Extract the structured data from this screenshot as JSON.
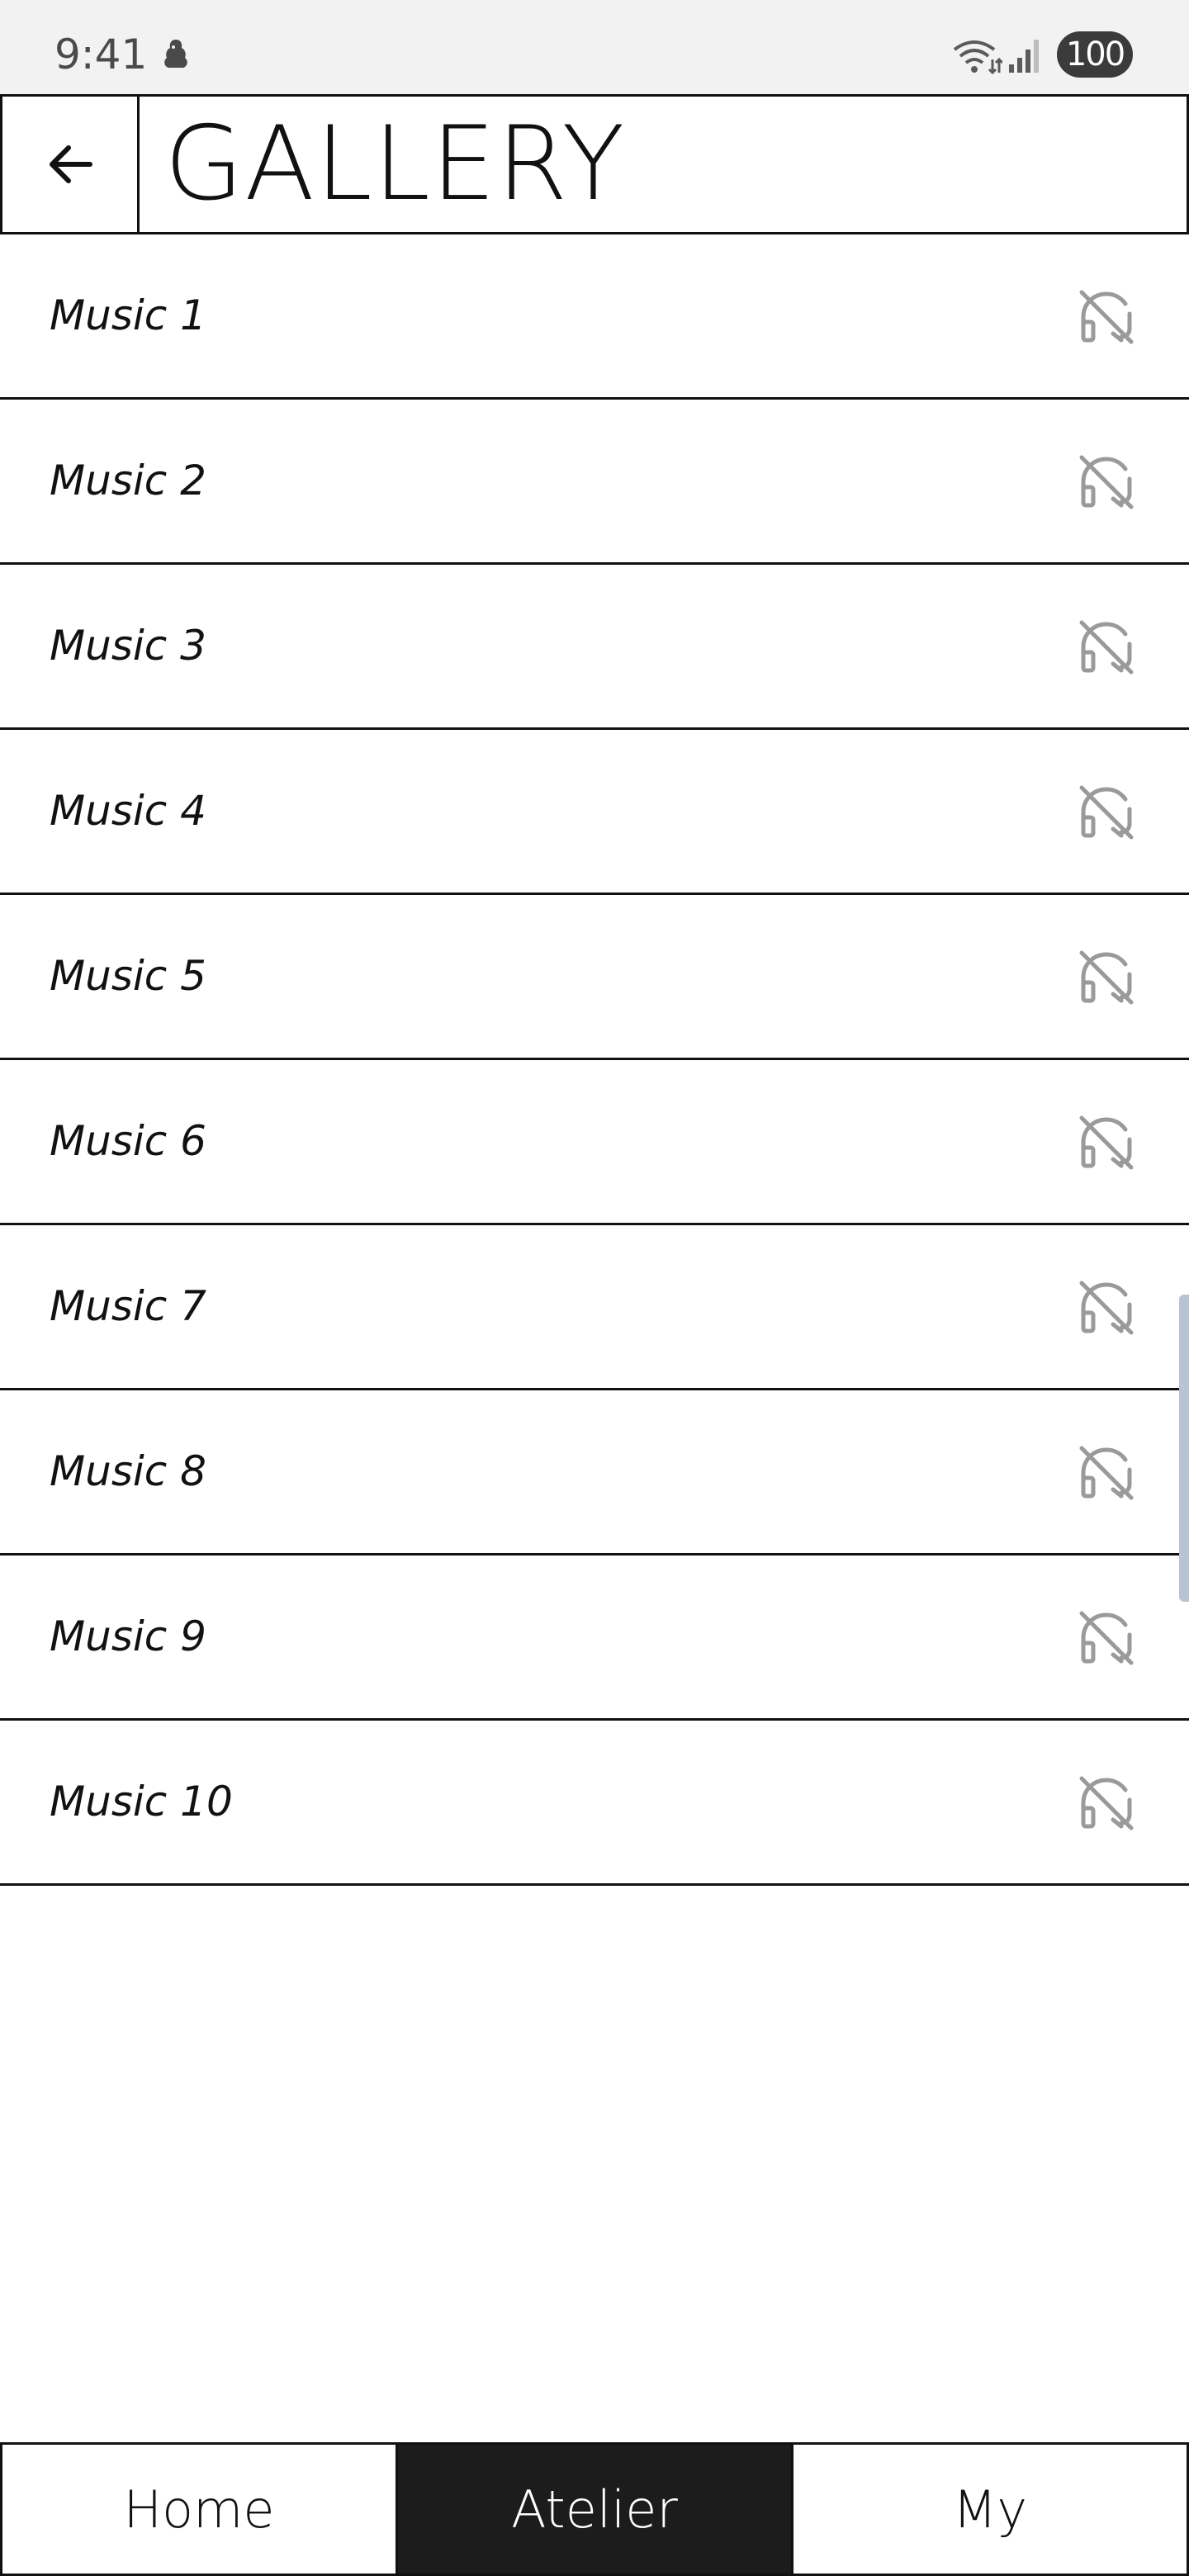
{
  "status_bar": {
    "time": "9:41",
    "battery": "100",
    "icons": [
      "notification-app-icon",
      "wifi-icon",
      "signal-icon",
      "battery-icon"
    ]
  },
  "header": {
    "title": "GALLERY",
    "back_icon": "arrow-left-icon"
  },
  "music_list": {
    "items": [
      {
        "label": "Music 1",
        "icon": "headphones-off-icon"
      },
      {
        "label": "Music 2",
        "icon": "headphones-off-icon"
      },
      {
        "label": "Music 3",
        "icon": "headphones-off-icon"
      },
      {
        "label": "Music 4",
        "icon": "headphones-off-icon"
      },
      {
        "label": "Music 5",
        "icon": "headphones-off-icon"
      },
      {
        "label": "Music 6",
        "icon": "headphones-off-icon"
      },
      {
        "label": "Music 7",
        "icon": "headphones-off-icon"
      },
      {
        "label": "Music 8",
        "icon": "headphones-off-icon"
      },
      {
        "label": "Music 9",
        "icon": "headphones-off-icon"
      },
      {
        "label": "Music 10",
        "icon": "headphones-off-icon"
      }
    ]
  },
  "bottom_nav": {
    "tabs": [
      {
        "label": "Home",
        "active": false
      },
      {
        "label": "Atelier",
        "active": true
      },
      {
        "label": "My",
        "active": false
      }
    ]
  },
  "colors": {
    "text": "#111111",
    "icon_gray": "#9a9a9a",
    "active_tab_bg": "#1c1c1c",
    "status_bar_bg": "#f2f2f2"
  }
}
